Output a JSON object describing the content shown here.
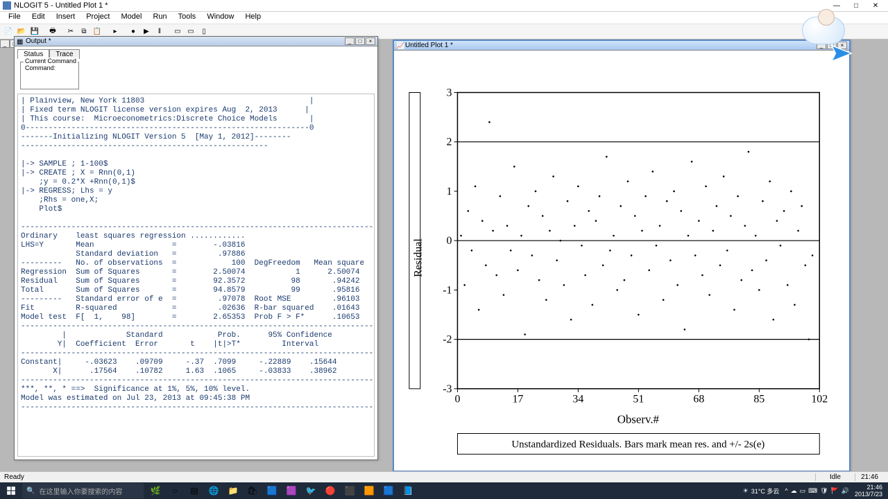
{
  "app": {
    "title": "NLOGIT 5 - Untitled Plot 1 *"
  },
  "menu": [
    "File",
    "Edit",
    "Insert",
    "Project",
    "Model",
    "Run",
    "Tools",
    "Window",
    "Help"
  ],
  "output_window": {
    "title": "Output *",
    "tabs": {
      "status": "Status",
      "trace": "Trace"
    },
    "command_legend": "Current Command",
    "command_label": "Command:",
    "text": "| Plainview, New York 11803                                    |\n| Fixed term NLOGIT license version expires Aug  2, 2013      |\n| This course:  Microeconometrics:Discrete Choice Models       |\n0--------------------------------------------------------------0\n-------Initializing NLOGIT Version 5  [May 1, 2012]--------\n------------------------------------------------------\n\n|-> SAMPLE ; 1-100$\n|-> CREATE ; X = Rnn(0,1)\n    ;y = 0.2*X +Rnn(0,1)$\n|-> REGRESS; Lhs = y\n    ;Rhs = one,X;\n    Plot$\n\n-----------------------------------------------------------------------------\nOrdinary    least squares regression ............\nLHS=Y       Mean                 =        -.03816\n            Standard deviation   =         .97886\n---------   No. of observations  =            100  DegFreedom   Mean square\nRegression  Sum of Squares       =        2.50074           1      2.50074\nResidual    Sum of Squares       =        92.3572          98       .94242\nTotal       Sum of Squares       =        94.8579          99       .95816\n---------   Standard error of e  =         .97078  Root MSE         .96103\nFit         R-squared            =         .02636  R-bar squared    .01643\nModel test  F[  1,    98]        =        2.65353  Prob F > F*      .10653\n-----------------------------------------------------------------------------\n         |             Standard            Prob.      95% Confidence\n        Y|  Coefficient  Error       t    |t|>T*         Interval\n-----------------------------------------------------------------------------\nConstant|     -.03623    .09709     -.37  .7099     -.22889    .15644\n       X|      .17564    .10782     1.63  .1065     -.03833    .38962\n-----------------------------------------------------------------------------\n***, **, * ==>  Significance at 1%, 5%, 10% level.\nModel was estimated on Jul 23, 2013 at 09:45:38 PM\n-----------------------------------------------------------------------------"
  },
  "plot_window": {
    "title": "Untitled Plot 1 *",
    "ylabel": "Residual",
    "xlabel": "Observ.#",
    "caption": "Unstandardized Residuals. Bars mark mean res. and +/- 2s(e)",
    "yticks": [
      "3",
      "2",
      "1",
      "0",
      "-1",
      "-2",
      "-3"
    ],
    "xticks": [
      "0",
      "17",
      "34",
      "51",
      "68",
      "85",
      "102"
    ]
  },
  "chart_data": {
    "type": "scatter",
    "title": "Unstandardized Residuals. Bars mark mean res. and +/- 2s(e)",
    "xlabel": "Observ.#",
    "ylabel": "Residual",
    "xlim": [
      0,
      102
    ],
    "ylim": [
      -3,
      3
    ],
    "reference_lines_y": [
      -2,
      0,
      2
    ],
    "points": [
      {
        "x": 1,
        "y": 0.1
      },
      {
        "x": 2,
        "y": -0.9
      },
      {
        "x": 3,
        "y": 0.6
      },
      {
        "x": 4,
        "y": -0.2
      },
      {
        "x": 5,
        "y": 1.1
      },
      {
        "x": 6,
        "y": -1.4
      },
      {
        "x": 7,
        "y": 0.4
      },
      {
        "x": 8,
        "y": -0.5
      },
      {
        "x": 9,
        "y": 2.4
      },
      {
        "x": 10,
        "y": 0.2
      },
      {
        "x": 11,
        "y": -0.7
      },
      {
        "x": 12,
        "y": 0.9
      },
      {
        "x": 13,
        "y": -1.1
      },
      {
        "x": 14,
        "y": 0.3
      },
      {
        "x": 15,
        "y": -0.2
      },
      {
        "x": 16,
        "y": 1.5
      },
      {
        "x": 17,
        "y": -0.6
      },
      {
        "x": 18,
        "y": 0.1
      },
      {
        "x": 19,
        "y": -1.9
      },
      {
        "x": 20,
        "y": 0.7
      },
      {
        "x": 21,
        "y": -0.3
      },
      {
        "x": 22,
        "y": 1.0
      },
      {
        "x": 23,
        "y": -0.8
      },
      {
        "x": 24,
        "y": 0.5
      },
      {
        "x": 25,
        "y": -1.2
      },
      {
        "x": 26,
        "y": 0.2
      },
      {
        "x": 27,
        "y": 1.3
      },
      {
        "x": 28,
        "y": -0.4
      },
      {
        "x": 29,
        "y": 0.0
      },
      {
        "x": 30,
        "y": -0.9
      },
      {
        "x": 31,
        "y": 0.8
      },
      {
        "x": 32,
        "y": -1.6
      },
      {
        "x": 33,
        "y": 0.3
      },
      {
        "x": 34,
        "y": 1.1
      },
      {
        "x": 35,
        "y": -0.1
      },
      {
        "x": 36,
        "y": -0.7
      },
      {
        "x": 37,
        "y": 0.6
      },
      {
        "x": 38,
        "y": -1.3
      },
      {
        "x": 39,
        "y": 0.4
      },
      {
        "x": 40,
        "y": 0.9
      },
      {
        "x": 41,
        "y": -0.5
      },
      {
        "x": 42,
        "y": 1.7
      },
      {
        "x": 43,
        "y": -0.2
      },
      {
        "x": 44,
        "y": 0.1
      },
      {
        "x": 45,
        "y": -1.0
      },
      {
        "x": 46,
        "y": 0.7
      },
      {
        "x": 47,
        "y": -0.8
      },
      {
        "x": 48,
        "y": 1.2
      },
      {
        "x": 49,
        "y": -0.3
      },
      {
        "x": 50,
        "y": 0.5
      },
      {
        "x": 51,
        "y": -1.5
      },
      {
        "x": 52,
        "y": 0.2
      },
      {
        "x": 53,
        "y": 0.9
      },
      {
        "x": 54,
        "y": -0.6
      },
      {
        "x": 55,
        "y": 1.4
      },
      {
        "x": 56,
        "y": -0.1
      },
      {
        "x": 57,
        "y": 0.3
      },
      {
        "x": 58,
        "y": -1.2
      },
      {
        "x": 59,
        "y": 0.8
      },
      {
        "x": 60,
        "y": -0.4
      },
      {
        "x": 61,
        "y": 1.0
      },
      {
        "x": 62,
        "y": -0.9
      },
      {
        "x": 63,
        "y": 0.6
      },
      {
        "x": 64,
        "y": -1.8
      },
      {
        "x": 65,
        "y": 0.1
      },
      {
        "x": 66,
        "y": 1.6
      },
      {
        "x": 67,
        "y": -0.3
      },
      {
        "x": 68,
        "y": 0.4
      },
      {
        "x": 69,
        "y": -0.7
      },
      {
        "x": 70,
        "y": 1.1
      },
      {
        "x": 71,
        "y": -1.1
      },
      {
        "x": 72,
        "y": 0.2
      },
      {
        "x": 73,
        "y": 0.7
      },
      {
        "x": 74,
        "y": -0.5
      },
      {
        "x": 75,
        "y": 1.3
      },
      {
        "x": 76,
        "y": -0.2
      },
      {
        "x": 77,
        "y": 0.5
      },
      {
        "x": 78,
        "y": -1.4
      },
      {
        "x": 79,
        "y": 0.9
      },
      {
        "x": 80,
        "y": -0.8
      },
      {
        "x": 81,
        "y": 0.3
      },
      {
        "x": 82,
        "y": 1.8
      },
      {
        "x": 83,
        "y": -0.6
      },
      {
        "x": 84,
        "y": 0.1
      },
      {
        "x": 85,
        "y": -1.0
      },
      {
        "x": 86,
        "y": 0.8
      },
      {
        "x": 87,
        "y": -0.4
      },
      {
        "x": 88,
        "y": 1.2
      },
      {
        "x": 89,
        "y": -1.6
      },
      {
        "x": 90,
        "y": 0.4
      },
      {
        "x": 91,
        "y": -0.1
      },
      {
        "x": 92,
        "y": 0.6
      },
      {
        "x": 93,
        "y": -0.9
      },
      {
        "x": 94,
        "y": 1.0
      },
      {
        "x": 95,
        "y": -1.3
      },
      {
        "x": 96,
        "y": 0.2
      },
      {
        "x": 97,
        "y": 0.7
      },
      {
        "x": 98,
        "y": -0.5
      },
      {
        "x": 99,
        "y": -2.0
      },
      {
        "x": 100,
        "y": -0.3
      }
    ]
  },
  "status": {
    "left": "Ready",
    "center": "Idle",
    "right": "21:46"
  },
  "taskbar": {
    "search_placeholder": "在这里输入你要搜索的内容",
    "weather": "31°C 多云",
    "time": "21:46",
    "date": "2013/7/23"
  }
}
